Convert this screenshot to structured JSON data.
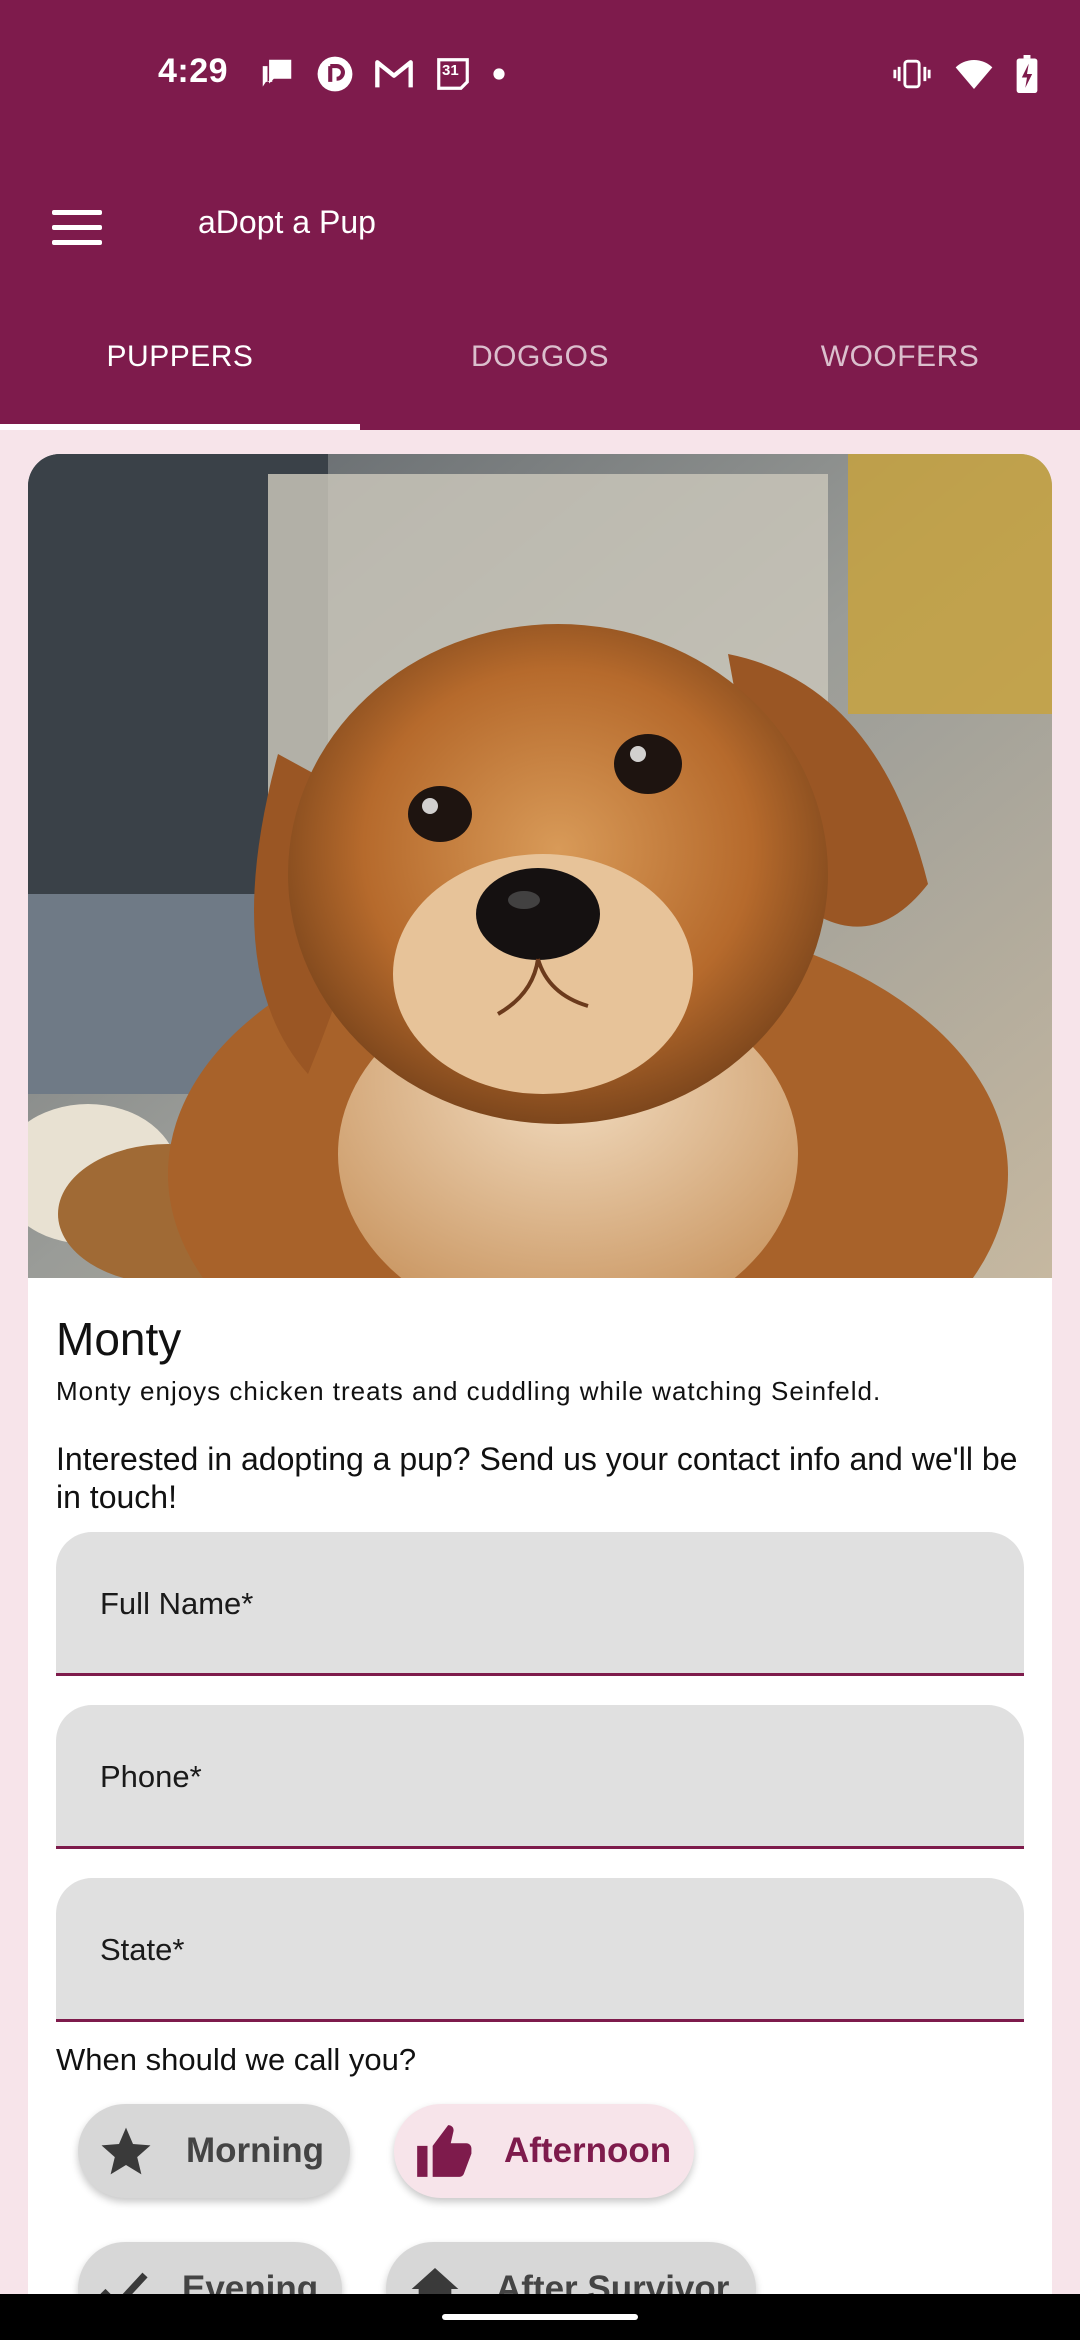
{
  "status_bar": {
    "time": "4:29",
    "left_icons": [
      "chat-notification-icon",
      "pocket-casts-icon",
      "gmail-icon",
      "calendar-icon",
      "dot-icon"
    ],
    "calendar_day": "31",
    "right_icons": [
      "vibrate-icon",
      "wifi-icon",
      "battery-charging-icon"
    ]
  },
  "app_bar": {
    "title": "aDopt a Pup",
    "menu_icon": "hamburger-menu-icon"
  },
  "tabs": [
    {
      "label": "PUPPERS",
      "active": true
    },
    {
      "label": "DOGGOS",
      "active": false
    },
    {
      "label": "WOOFERS",
      "active": false
    }
  ],
  "pup": {
    "name": "Monty",
    "description": "Monty enjoys chicken treats and cuddling while watching Seinfeld."
  },
  "form": {
    "intro": "Interested in adopting a pup? Send us your contact info and we'll be in touch!",
    "fields": [
      {
        "label": "Full Name*"
      },
      {
        "label": "Phone*"
      },
      {
        "label": "State*"
      }
    ],
    "call_question": "When should we call you?",
    "chips": [
      {
        "label": "Morning",
        "icon": "star-icon",
        "selected": false
      },
      {
        "label": "Afternoon",
        "icon": "thumbs-up-icon",
        "selected": true
      },
      {
        "label": "Evening",
        "icon": "check-icon",
        "selected": false
      },
      {
        "label": "After Survivor",
        "icon": "home-icon",
        "selected": false
      }
    ]
  },
  "colors": {
    "primary": "#7e1b4c",
    "background": "#f7e4ea",
    "field_fill": "#e0e0e0",
    "chip_grey": "#d7d7d7"
  }
}
